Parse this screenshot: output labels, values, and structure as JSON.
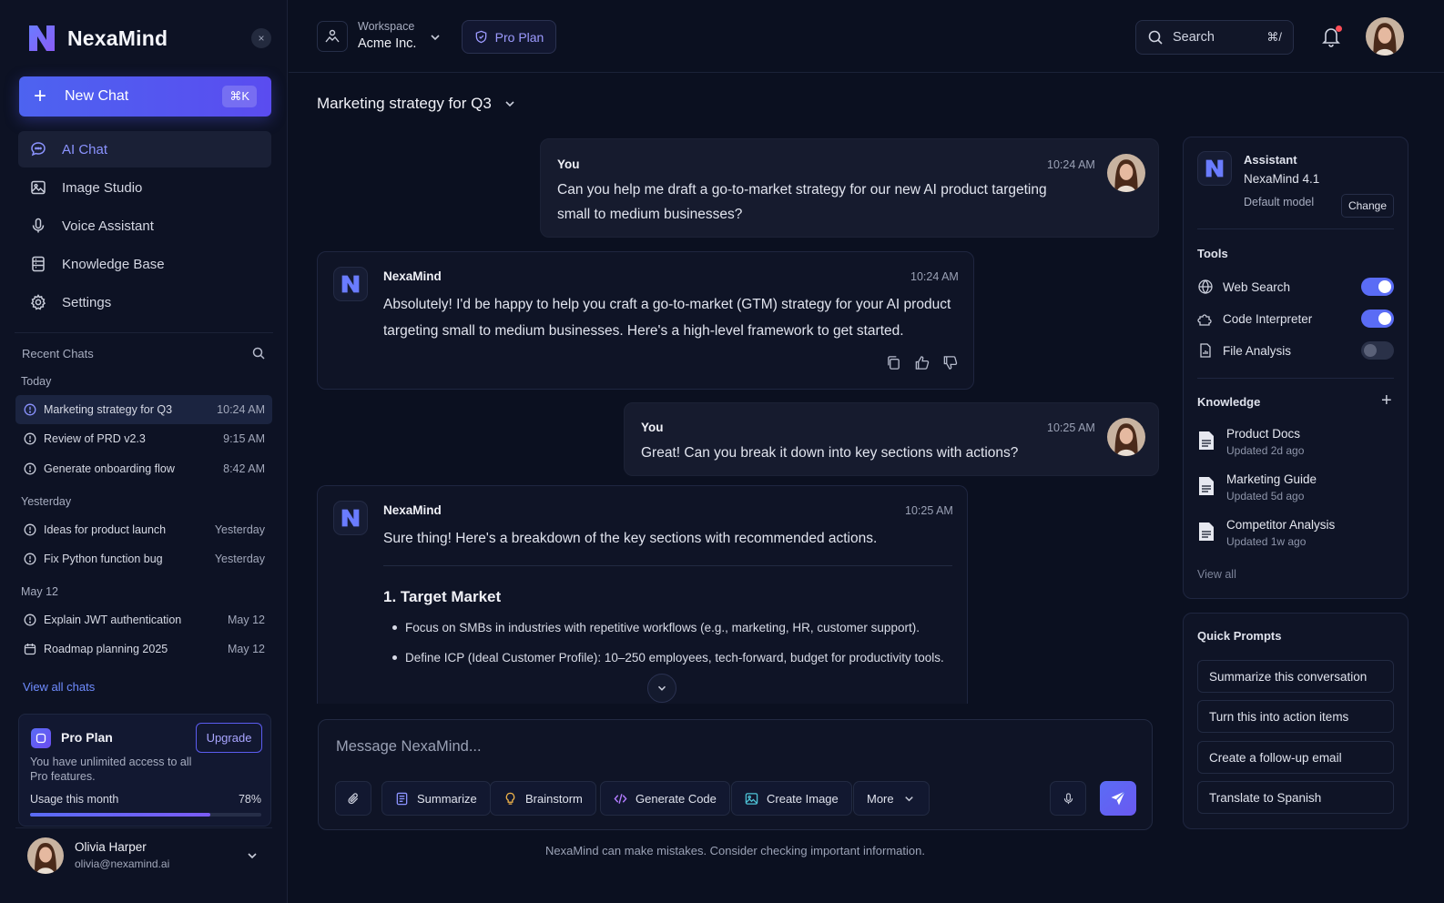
{
  "brand": {
    "name": "NexaMind"
  },
  "sidebar": {
    "collapse_glyph": "×",
    "new_chat": {
      "label": "New Chat",
      "shortcut": "⌘K"
    },
    "nav": [
      {
        "label": "AI Chat",
        "icon": "chat-bubble-icon",
        "active": true
      },
      {
        "label": "Image Studio",
        "icon": "image-icon"
      },
      {
        "label": "Voice Assistant",
        "icon": "microphone-icon"
      },
      {
        "label": "Knowledge Base",
        "icon": "database-icon"
      },
      {
        "label": "Settings",
        "icon": "gear-icon"
      }
    ],
    "recent_label": "Recent Chats",
    "groups": [
      {
        "label": "Today",
        "items": [
          {
            "title": "Marketing strategy for Q3",
            "time": "10:24 AM",
            "active": true
          },
          {
            "title": "Review of PRD v2.3",
            "time": "9:15 AM"
          },
          {
            "title": "Generate onboarding flow",
            "time": "8:42 AM"
          }
        ]
      },
      {
        "label": "Yesterday",
        "items": [
          {
            "title": "Ideas for product launch",
            "time": "Yesterday"
          },
          {
            "title": "Fix Python function bug",
            "time": "Yesterday"
          }
        ]
      },
      {
        "label": "May 12",
        "items": [
          {
            "title": "Explain JWT authentication",
            "time": "May 12"
          },
          {
            "title": "Roadmap planning 2025",
            "time": "May 12"
          }
        ]
      }
    ],
    "view_all": "View all chats",
    "pro_card": {
      "title": "Pro Plan",
      "upgrade": "Upgrade",
      "description": "You have unlimited access to all Pro features.",
      "usage_label": "Usage this month",
      "usage_percent": "78%",
      "usage_value": 0.78
    },
    "user": {
      "name": "Olivia Harper",
      "email": "olivia@nexamind.ai"
    }
  },
  "header": {
    "workspace_label": "Workspace",
    "workspace_name": "Acme Inc.",
    "plan_pill": "Pro Plan",
    "search_placeholder": "Search",
    "search_shortcut": "⌘/",
    "has_notification": true
  },
  "chat": {
    "title": "Marketing strategy for Q3",
    "messages": [
      {
        "role": "user",
        "author": "You",
        "time": "10:24 AM",
        "lines": [
          "Can you help me draft a go-to-market strategy for our new AI product targeting",
          "small to medium businesses?"
        ]
      },
      {
        "role": "assistant",
        "author": "NexaMind",
        "time": "10:24 AM",
        "lines": [
          "Absolutely! I'd be happy to help you craft a go-to-market (GTM) strategy for your AI product",
          "targeting small to medium businesses. Here's a high-level framework to get started."
        ]
      },
      {
        "role": "user",
        "author": "You",
        "time": "10:25 AM",
        "lines": [
          "Great! Can you break it down into key sections with actions?"
        ]
      },
      {
        "role": "assistant",
        "author": "NexaMind",
        "time": "10:25 AM",
        "lines": [
          "Sure thing! Here's a breakdown of the key sections with recommended actions."
        ],
        "section": {
          "number": "1.",
          "title": "Target Market",
          "bullets": [
            "Focus on SMBs in industries with repetitive workflows (e.g., marketing, HR, customer support).",
            "Define ICP (Ideal Customer Profile): 10–250 employees, tech-forward, budget for productivity tools."
          ]
        }
      }
    ]
  },
  "composer": {
    "placeholder": "Message NexaMind...",
    "actions": [
      {
        "label": "Summarize",
        "icon": "summarize-icon"
      },
      {
        "label": "Brainstorm",
        "icon": "lightbulb-icon"
      },
      {
        "label": "Generate Code",
        "icon": "code-icon"
      },
      {
        "label": "Create Image",
        "icon": "image-icon"
      },
      {
        "label": "More",
        "icon": "chevron-down-icon"
      }
    ],
    "disclaimer": "NexaMind can make mistakes. Consider checking important information."
  },
  "right_panel": {
    "assistant": {
      "label": "Assistant",
      "model": "NexaMind 4.1",
      "default_label": "Default model",
      "change": "Change"
    },
    "tools_label": "Tools",
    "tools": [
      {
        "label": "Web Search",
        "icon": "globe-icon",
        "enabled": true
      },
      {
        "label": "Code Interpreter",
        "icon": "puzzle-icon",
        "enabled": true
      },
      {
        "label": "File Analysis",
        "icon": "file-chart-icon",
        "enabled": false
      }
    ],
    "knowledge_label": "Knowledge",
    "knowledge": [
      {
        "title": "Product Docs",
        "updated": "Updated 2d ago"
      },
      {
        "title": "Marketing Guide",
        "updated": "Updated 5d ago"
      },
      {
        "title": "Competitor Analysis",
        "updated": "Updated 1w ago"
      }
    ],
    "view_all": "View all",
    "quick_prompts_label": "Quick Prompts",
    "quick_prompts": [
      "Summarize this conversation",
      "Turn this into action items",
      "Create a follow-up email",
      "Translate to Spanish"
    ]
  },
  "colors": {
    "accent": "#5a6cf5",
    "background": "#0b1020",
    "panel": "#0f1426",
    "link": "#6f8cff",
    "notification": "#ff4d57"
  }
}
